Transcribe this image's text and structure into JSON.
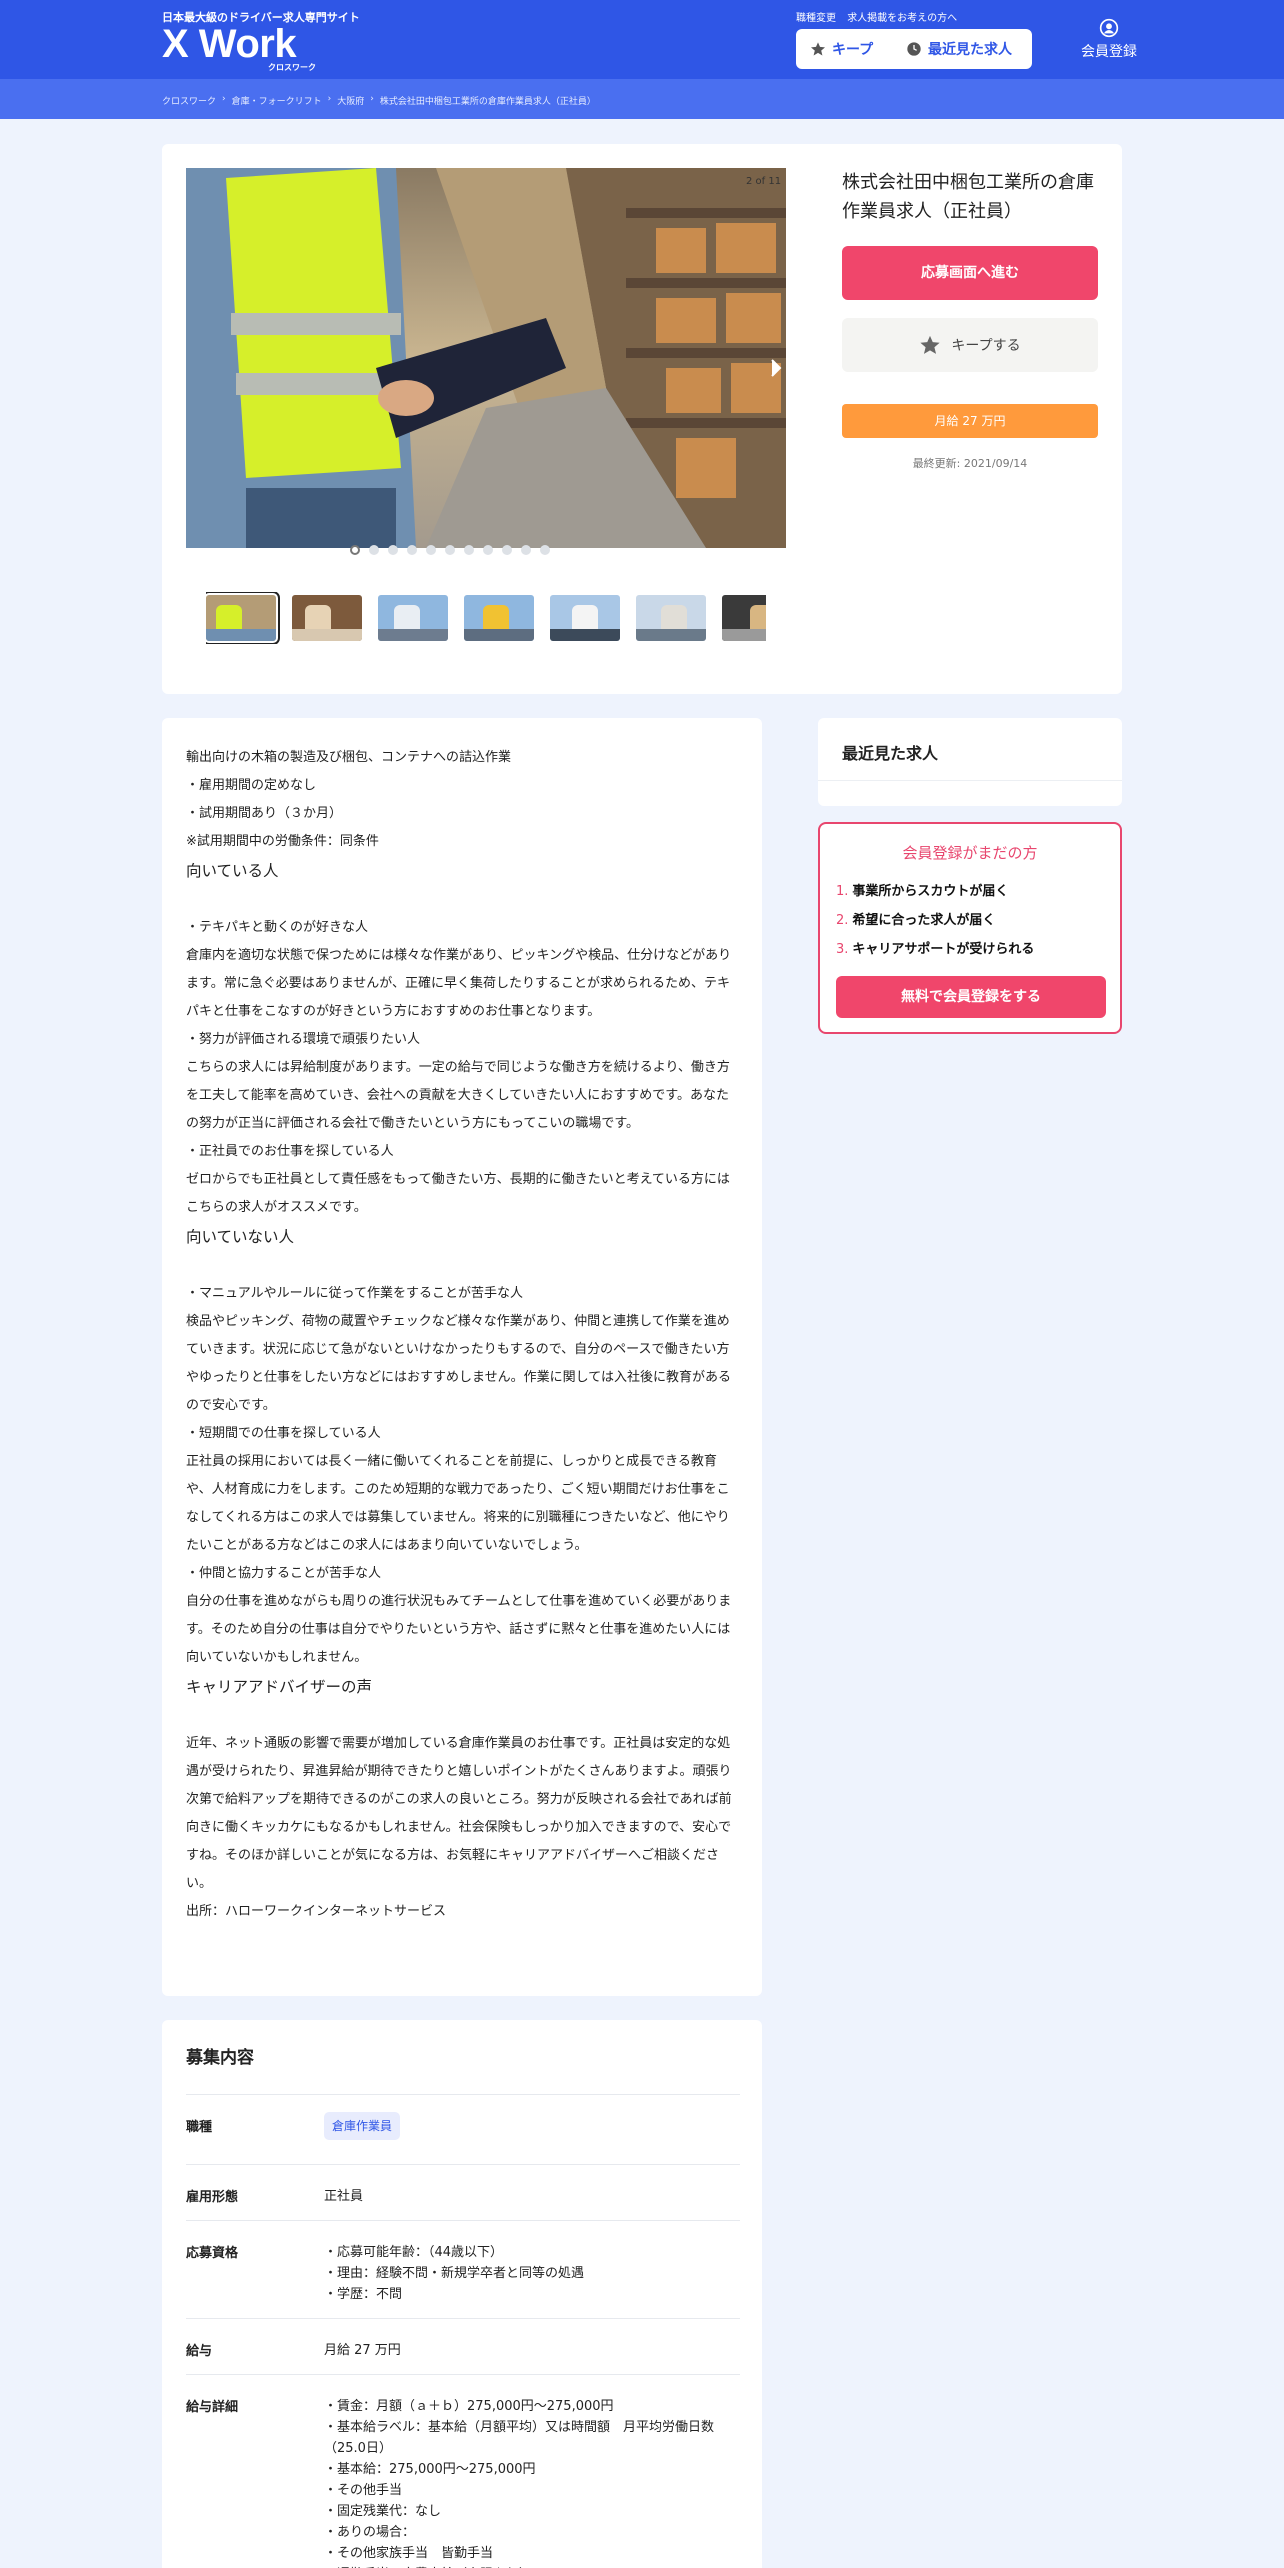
{
  "header": {
    "tagline": "日本最大級のドライバー求人専門サイト",
    "logo": "X Work",
    "logo_sub": "クロスワーク",
    "links": [
      "職種変更",
      "求人掲載をお考えの方へ"
    ],
    "keep_label": "キープ",
    "recent_label": "最近見た求人",
    "member_label": "会員登録"
  },
  "breadcrumb": [
    "クロスワーク",
    "倉庫・フォークリフト",
    "大阪府",
    "株式会社田中梱包工業所の倉庫作業員求人（正社員）"
  ],
  "gallery": {
    "counter": "2 of 11",
    "dots": 11,
    "active_dot": 0,
    "thumbnail_count": 7
  },
  "job": {
    "title": "株式会社田中梱包工業所の倉庫作業員求人（正社員）",
    "apply_label": "応募画面へ進む",
    "keep_label": "キープする",
    "salary_badge": "月給 27 万円",
    "updated": "最終更新: 2021/09/14"
  },
  "description": [
    {
      "t": "p",
      "text": "輸出向けの木箱の製造及び梱包、コンテナへの詰込作業"
    },
    {
      "t": "p",
      "text": "・雇用期間の定めなし"
    },
    {
      "t": "p",
      "text": "・試用期間あり（３か月）"
    },
    {
      "t": "p",
      "text": "※試用期間中の労働条件：同条件"
    },
    {
      "t": "h",
      "text": "向いている人"
    },
    {
      "t": "blank",
      "text": ""
    },
    {
      "t": "p",
      "text": "・テキパキと動くのが好きな人"
    },
    {
      "t": "p",
      "text": "倉庫内を適切な状態で保つためには様々な作業があり、ピッキングや検品、仕分けなどがあります。常に急ぐ必要はありませんが、正確に早く集荷したりすることが求められるため、テキパキと仕事をこなすのが好きという方におすすめのお仕事となります。"
    },
    {
      "t": "p",
      "text": "・努力が評価される環境で頑張りたい人"
    },
    {
      "t": "p",
      "text": "こちらの求人には昇給制度があります。一定の給与で同じような働き方を続けるより、働き方を工夫して能率を高めていき、会社への貢献を大きくしていきたい人におすすめです。あなたの努力が正当に評価される会社で働きたいという方にもってこいの職場です。"
    },
    {
      "t": "p",
      "text": "・正社員でのお仕事を探している人"
    },
    {
      "t": "p",
      "text": "ゼロからでも正社員として責任感をもって働きたい方、長期的に働きたいと考えている方にはこちらの求人がオススメです。"
    },
    {
      "t": "h",
      "text": "向いていない人"
    },
    {
      "t": "blank",
      "text": ""
    },
    {
      "t": "p",
      "text": "・マニュアルやルールに従って作業をすることが苦手な人"
    },
    {
      "t": "p",
      "text": "検品やピッキング、荷物の蔵置やチェックなど様々な作業があり、仲間と連携して作業を進めていきます。状況に応じて急がないといけなかったりもするので、自分のペースで働きたい方やゆったりと仕事をしたい方などにはおすすめしません。作業に関しては入社後に教育があるので安心です。"
    },
    {
      "t": "p",
      "text": "・短期間での仕事を探している人"
    },
    {
      "t": "p",
      "text": "正社員の採用においては長く一緒に働いてくれることを前提に、しっかりと成長できる教育や、人材育成に力をします。このため短期的な戦力であったり、ごく短い期間だけお仕事をこなしてくれる方はこの求人では募集していません。将来的に別職種につきたいなど、他にやりたいことがある方などはこの求人にはあまり向いていないでしょう。"
    },
    {
      "t": "p",
      "text": "・仲間と協力することが苦手な人"
    },
    {
      "t": "p",
      "text": "自分の仕事を進めながらも周りの進行状況もみてチームとして仕事を進めていく必要があります。そのため自分の仕事は自分でやりたいという方や、話さずに黙々と仕事を進めたい人には向いていないかもしれません。"
    },
    {
      "t": "h",
      "text": "キャリアアドバイザーの声"
    },
    {
      "t": "blank",
      "text": ""
    },
    {
      "t": "p",
      "text": "近年、ネット通販の影響で需要が増加している倉庫作業員のお仕事です。正社員は安定的な処遇が受けられたり、昇進昇給が期待できたりと嬉しいポイントがたくさんありますよ。頑張り次第で給料アップを期待できるのがこの求人の良いところ。努力が反映される会社であれば前向きに働くキッカケにもなるかもしれません。社会保険もしっかり加入できますので、安心ですね。そのほか詳しいことが気になる方は、お気軽にキャリアアドバイザーへご相談ください。"
    },
    {
      "t": "p",
      "text": "出所：ハローワークインターネットサービス"
    }
  ],
  "sidebar": {
    "recent_title": "最近見た求人",
    "signup_title": "会員登録がまだの方",
    "benefits": [
      {
        "num": "1.",
        "text": "事業所からスカウトが届く"
      },
      {
        "num": "2.",
        "text": "希望に合った求人が届く"
      },
      {
        "num": "3.",
        "text": "キャリアサポートが受けられる"
      }
    ],
    "signup_button": "無料で会員登録をする"
  },
  "recruitment": {
    "title": "募集内容",
    "rows": [
      {
        "label": "職種",
        "tag": "倉庫作業員",
        "lines": []
      },
      {
        "label": "雇用形態",
        "tag": "",
        "lines": [
          "正社員"
        ]
      },
      {
        "label": "応募資格",
        "tag": "",
        "lines": [
          "・応募可能年齢：（44歳以下）",
          "・理由：経験不問・新規学卒者と同等の処遇",
          "・学歴：不問"
        ]
      },
      {
        "label": "給与",
        "tag": "",
        "lines": [
          "月給 27 万円"
        ]
      },
      {
        "label": "給与詳細",
        "tag": "",
        "lines": [
          "・賃金：月額（ａ＋ｂ）275,000円〜275,000円",
          "・基本給ラベル：基本給（月額平均）又は時間額　月平均労働日数（25.0日）",
          "・基本給：275,000円〜275,000円",
          "・その他手当",
          "・固定残業代：なし",
          "・ありの場合：",
          "・その他家族手当　皆勤手当",
          "・通勤手当：実費支給（上限あり）"
        ]
      }
    ]
  }
}
